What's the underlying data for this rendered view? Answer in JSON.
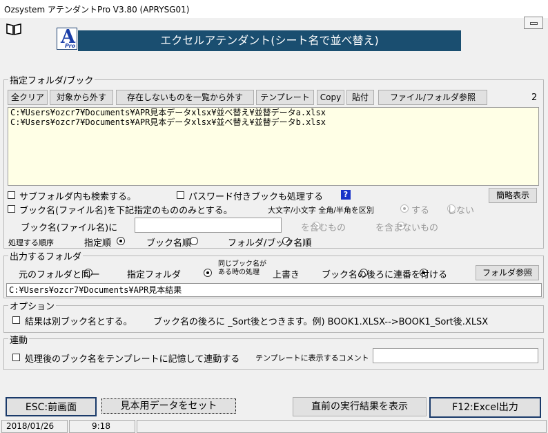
{
  "window": {
    "title": "Ozsystem アテンダントPro V3.80 (APRYSG01)"
  },
  "banner": {
    "title": "エクセルアテンダント(シート名で並べ替え)",
    "logo_letter": "A",
    "logo_sub": "Pro"
  },
  "folder_group": {
    "label": "指定フォルダ/ブック",
    "count": "2",
    "buttons": [
      "全クリア",
      "対象から外す",
      "存在しないものを一覧から外す",
      "テンプレート",
      "Copy",
      "貼付",
      "ファイル/フォルダ参照"
    ],
    "files": [
      "C:¥Users¥ozcr7¥Documents¥APR見本データxlsx¥並べ替え¥並替データa.xlsx",
      "C:¥Users¥ozcr7¥Documents¥APR見本データxlsx¥並べ替え¥並替データb.xlsx"
    ],
    "subfolder_label": "サブフォルダ内も検索する。",
    "password_label": "パスワード付きブックも処理する",
    "help": "?",
    "simple_view": "簡略表示",
    "bookname_filter_label": "ブック名(ファイル名)を下記指定のもののみとする。",
    "case_label": "大文字/小文字 全角/半角を区別",
    "yes": "する",
    "no": "しない",
    "bookname_prefix": "ブック名(ファイル名)に",
    "bookname_value": "",
    "contains": "を含むもの",
    "not_contains": "を含まないもの",
    "order_label": "処理する順序",
    "order_options": [
      "指定順",
      "ブック名順",
      "フォルダ/ブック名順"
    ]
  },
  "output_group": {
    "label": "出力するフォルダ",
    "same_folder": "元のフォルダと同一",
    "specified": "指定フォルダ",
    "dup_label_1": "同じブック名が",
    "dup_label_2": "ある時の処理",
    "overwrite": "上書き",
    "sequence": "ブック名の後ろに連番を付ける",
    "browse": "フォルダ参照",
    "path": "C:¥Users¥ozcr7¥Documents¥APR見本結果"
  },
  "options_group": {
    "label": "オプション",
    "separate_book": "結果は別ブック名とする。",
    "note": "ブック名の後ろに _Sort後とつきます。例) BOOK1.XLSX-->BOOK1_Sort後.XLSX"
  },
  "link_group": {
    "label": "連動",
    "remember": "処理後のブック名をテンプレートに記憶して連動する",
    "comment_label": "テンプレートに表示するコメント",
    "comment_value": ""
  },
  "footer": {
    "esc": "ESC:前画面",
    "sample": "見本用データをセット",
    "last_result": "直前の実行結果を表示",
    "run": "F12:Excel出力"
  },
  "statusbar": {
    "date": "2018/01/26",
    "time": "9:18"
  }
}
